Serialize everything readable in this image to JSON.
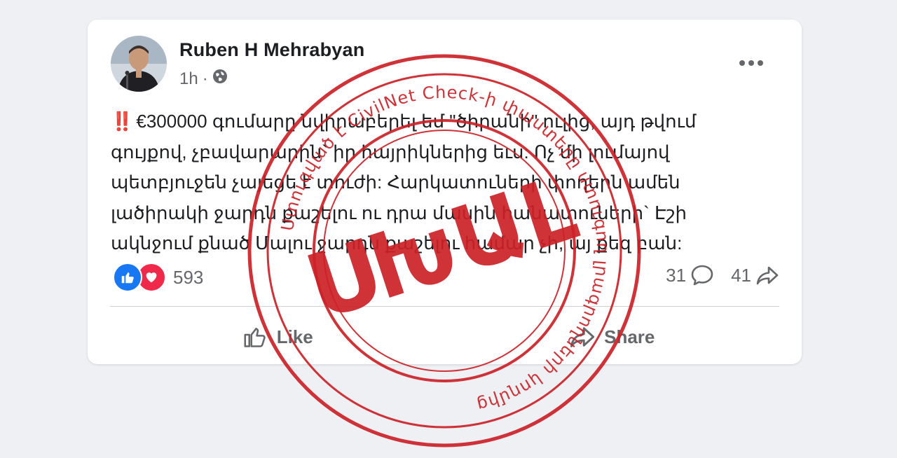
{
  "post": {
    "author": "Ruben H Mehrabyan",
    "time": "1h",
    "separator": "·",
    "alert_icon": "‼️",
    "lines": [
      "€300000 գումարը նվիրաբերել եմ \"ծիրանի\" ուլից, այդ թվում",
      "գույքով, չբավարարին` իր հայրիկներից եւս: Ոչ մի լումայով",
      "պետբյուջեն չայեցե է տուժի: Հարկատուների փողերն ամեն",
      "լածիրակի ջարդն քաշելու ու դրա մասին հանատուների` Էշի",
      "ակնջում քնած Մալու ջարդն քաշելու համար չի, այ քեզ բան:"
    ]
  },
  "reactions": {
    "count": "593",
    "icons": [
      "like-reaction",
      "love-reaction"
    ]
  },
  "counts": {
    "comments": "31",
    "shares": "41"
  },
  "actions": {
    "like": "Like",
    "share": "Share"
  },
  "stamp": {
    "main_text": "ՍԽԱԼ",
    "ring_text": "Ստուգված է CivilNet Check-ի փաստերը ստուգող լրագրողների կողմից",
    "color": "#cc2127"
  },
  "colors": {
    "background": "#eef0f4",
    "card": "#ffffff",
    "text": "#1c1e21",
    "muted": "#65676b",
    "accent": "#1877f2"
  }
}
